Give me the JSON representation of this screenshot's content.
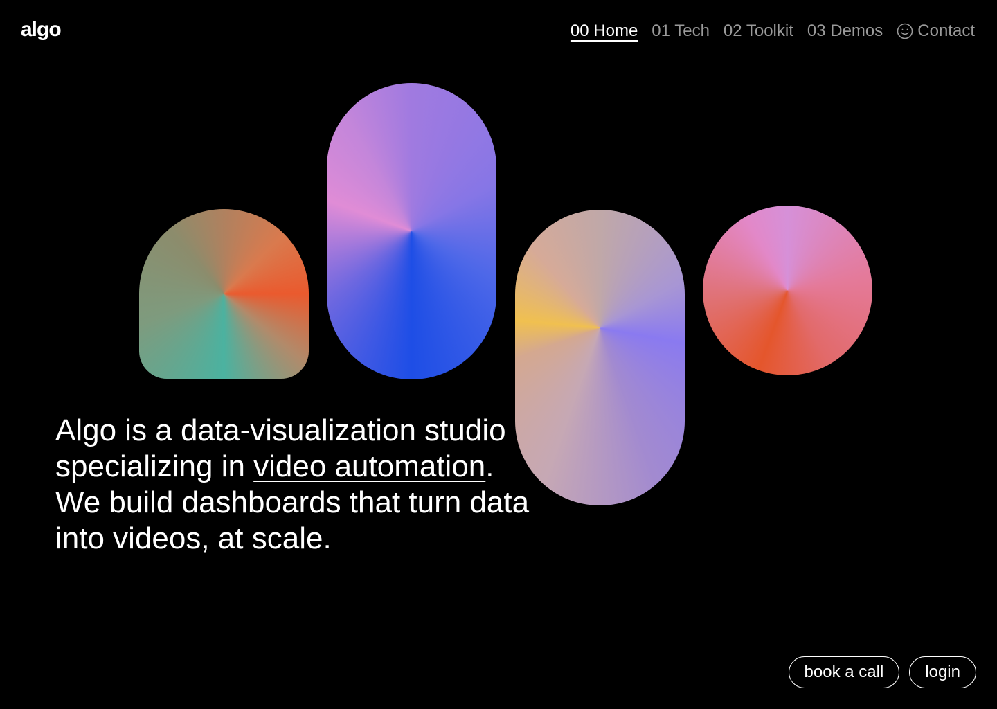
{
  "header": {
    "logo": "algo",
    "nav": [
      {
        "label": "00 Home",
        "active": true
      },
      {
        "label": "01 Tech",
        "active": false
      },
      {
        "label": "02 Toolkit",
        "active": false
      },
      {
        "label": "03 Demos",
        "active": false
      },
      {
        "label": "Contact",
        "icon": "smiley-icon",
        "active": false
      }
    ]
  },
  "hero": {
    "line1": "Algo is a data-visualization studio",
    "line2_prefix": "specializing in ",
    "line2_link": "video automation",
    "line2_suffix": ".",
    "line3": "We build dashboards that turn data",
    "line4": "into videos, at scale."
  },
  "actions": {
    "book_call_label": "book a call",
    "login_label": "login"
  },
  "colors": {
    "background": "#000000",
    "text": "#ffffff",
    "nav_inactive": "#9a9a9a",
    "shape_orange": "#ea5a2e",
    "shape_teal": "#4bb2a0",
    "shape_blue": "#1e4ee6",
    "shape_pink": "#e08cd6",
    "shape_yellow": "#f0c050",
    "shape_violet": "#8a7af0"
  }
}
